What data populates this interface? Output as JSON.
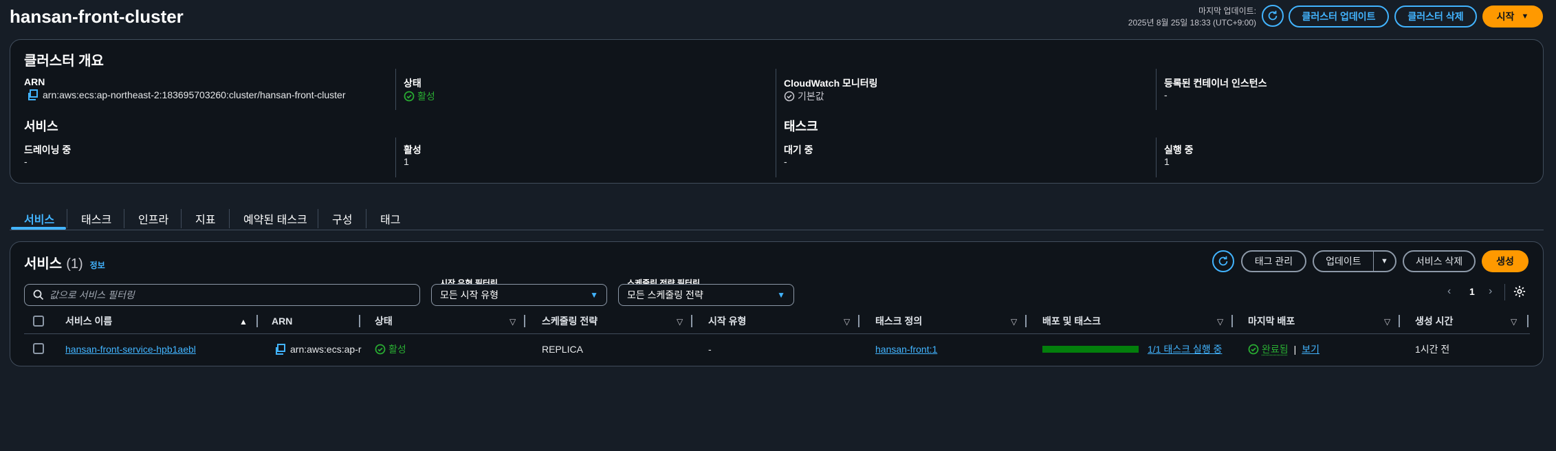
{
  "header": {
    "title": "hansan-front-cluster",
    "last_update_label": "마지막 업데이트:",
    "last_update_value": "2025년 8월 25일 18:33 (UTC+9:00)",
    "update_cluster": "클러스터 업데이트",
    "delete_cluster": "클러스터 삭제",
    "start": "시작"
  },
  "overview": {
    "title": "클러스터 개요",
    "arn_label": "ARN",
    "arn_value": "arn:aws:ecs:ap-northeast-2:183695703260:cluster/hansan-front-cluster",
    "status_label": "상태",
    "status_value": "활성",
    "cloudwatch_label": "CloudWatch 모니터링",
    "cloudwatch_value": "기본값",
    "instances_label": "등록된 컨테이너 인스턴스",
    "instances_value": "-",
    "services_title": "서비스",
    "draining_label": "드레이닝 중",
    "draining_value": "-",
    "active_label": "활성",
    "active_value": "1",
    "tasks_title": "태스크",
    "pending_label": "대기 중",
    "pending_value": "-",
    "running_label": "실행 중",
    "running_value": "1"
  },
  "tabs": [
    "서비스",
    "태스크",
    "인프라",
    "지표",
    "예약된 태스크",
    "구성",
    "태그"
  ],
  "services": {
    "title": "서비스",
    "count": "(1)",
    "info": "정보",
    "manage_tags": "태그 관리",
    "update": "업데이트",
    "delete": "서비스 삭제",
    "create": "생성",
    "search_placeholder": "값으로 서비스 필터링",
    "launch_filter_label": "시작 유형 필터링",
    "launch_filter_value": "모든 시작 유형",
    "scheduling_filter_label": "스케줄링 전략 필터링",
    "scheduling_filter_value": "모든 스케줄링 전략",
    "page": "1",
    "columns": [
      "서비스 이름",
      "ARN",
      "상태",
      "스케줄링 전략",
      "시작 유형",
      "태스크 정의",
      "배포 및 태스크",
      "마지막 배포",
      "생성 시간"
    ],
    "row": {
      "name": "hansan-front-service-hpb1aebl",
      "arn": "arn:aws:ecs:ap-r",
      "status": "활성",
      "scheduling": "REPLICA",
      "launch_type": "-",
      "task_def": "hansan-front:1",
      "deploy_progress": 1.0,
      "deploy_text": "1/1 태스크 실행 중",
      "last_deploy_status": "완료됨",
      "last_deploy_sep": "|",
      "view": "보기",
      "created": "1시간 전"
    }
  },
  "colors": {
    "accent": "#42b4ff",
    "primary": "#ff9900",
    "success": "#29ad32",
    "progress": "#037f0c"
  }
}
